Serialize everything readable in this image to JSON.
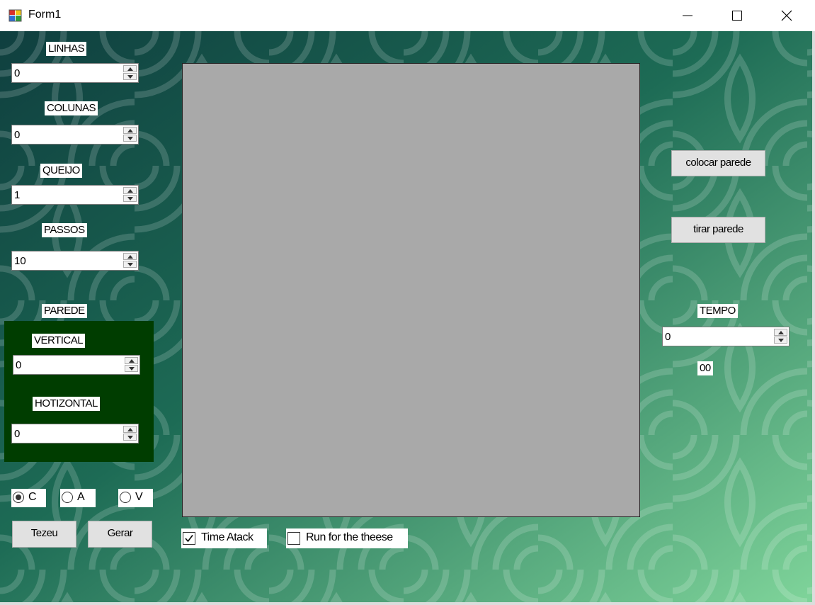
{
  "window": {
    "title": "Form1",
    "controls": [
      "minimize-icon",
      "maximize-icon",
      "close-icon"
    ]
  },
  "left_panel": {
    "linhas": {
      "label": "LINHAS",
      "value": "0"
    },
    "colunas": {
      "label": "COLUNAS",
      "value": "0"
    },
    "queijo": {
      "label": "QUEIJO",
      "value": "1"
    },
    "passos": {
      "label": "PASSOS",
      "value": "10"
    },
    "parede": {
      "label": "PAREDE",
      "vertical": {
        "label": "VERTICAL",
        "value": "0"
      },
      "horizontal": {
        "label": "HOTIZONTAL",
        "value": "0"
      }
    },
    "radios": [
      {
        "label": "C",
        "checked": true
      },
      {
        "label": "A",
        "checked": false
      },
      {
        "label": "V",
        "checked": false
      }
    ],
    "tezeu_button": "Tezeu",
    "gerar_button": "Gerar"
  },
  "bottom": {
    "time_atack": {
      "label": "Time Atack",
      "checked": true
    },
    "run_for_cheese": {
      "label": "Run for the theese",
      "checked": false
    }
  },
  "right_panel": {
    "colocar_parede_button": "colocar parede",
    "tirar_parede_button": "tirar parede",
    "tempo": {
      "label": "TEMPO",
      "value": "0"
    },
    "timer_display": "00"
  },
  "colors": {
    "background_dark": "#1f6a57",
    "background_light": "#7fd49a",
    "wall_panel": "#003d00",
    "canvas": "#a9a9a9"
  }
}
